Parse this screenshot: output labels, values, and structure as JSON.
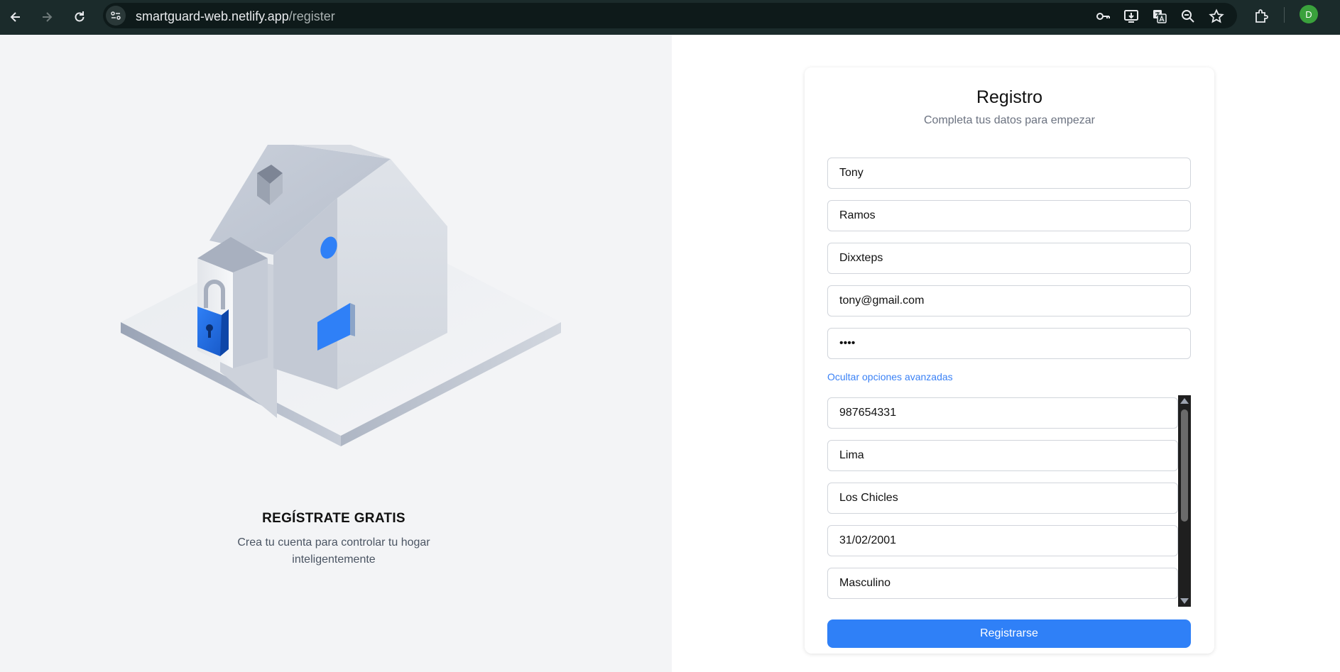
{
  "browser": {
    "url_host": "smartguard-web.netlify.app",
    "url_path": "/register",
    "avatar_letter": "D",
    "icons": [
      "back-icon",
      "forward-icon",
      "reload-icon",
      "site-info-icon",
      "password-key-icon",
      "install-app-icon",
      "translate-icon",
      "zoom-icon",
      "bookmark-star-icon",
      "extensions-icon"
    ]
  },
  "left_panel": {
    "title": "REGÍSTRATE GRATIS",
    "subtitle": "Crea tu cuenta para controlar tu hogar inteligentemente"
  },
  "form": {
    "title": "Registro",
    "subtitle": "Completa tus datos para empezar",
    "fields": {
      "first_name": "Tony",
      "last_name": "Ramos",
      "username": "Dixxteps",
      "email": "tony@gmail.com",
      "password": "tony"
    },
    "toggle_label": "Ocultar opciones avanzadas",
    "advanced": {
      "phone": "987654331",
      "city": "Lima",
      "district": "Los Chicles",
      "birthdate": "31/02/2001",
      "gender": "Masculino"
    },
    "submit_label": "Registrarse"
  },
  "colors": {
    "accent": "#2f80f7",
    "chrome_bg": "#1b2b2b",
    "left_bg": "#f3f4f6"
  }
}
